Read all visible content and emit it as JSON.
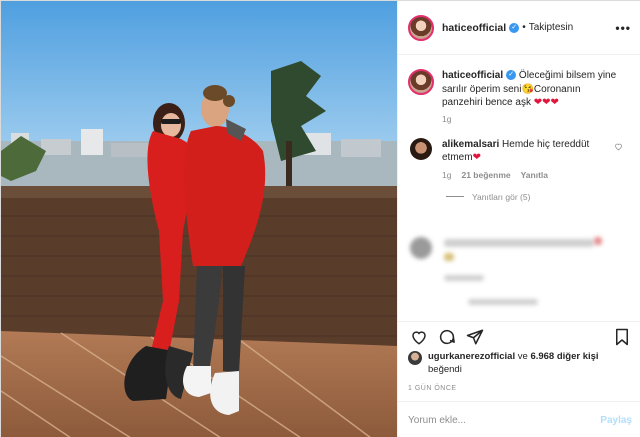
{
  "header": {
    "username": "haticeofficial",
    "separator": "•",
    "follow_status": "Takiptesin",
    "more_label": "•••"
  },
  "caption": {
    "username": "haticeofficial",
    "text_before_emoji": "Öleceğimi bilsem yine sarılır öperim seni",
    "text_after_emoji": "Coronanın panzehiri bence aşk",
    "hearts": "❤❤❤",
    "time": "1g"
  },
  "comment": {
    "username": "alikemalsari",
    "text": "Hemde hiç tereddüt etmem",
    "heart": "❤",
    "time": "1g",
    "likes": "21 beğenme",
    "reply_label": "Yanıtla",
    "view_replies": "Yanıtları gör (5)"
  },
  "likes": {
    "user": "ugurkanerezofficial",
    "connector": "ve",
    "count_text": "6.968 diğer kişi",
    "suffix": "beğendi"
  },
  "date": "1 GÜN ÖNCE",
  "comment_input": {
    "placeholder": "Yorum ekle...",
    "post_label": "Paylaş"
  },
  "icons": [
    "verified-icon",
    "more-icon",
    "heart-icon",
    "comment-icon",
    "share-icon",
    "bookmark-icon"
  ],
  "colors": {
    "accent_blue": "#3897f0",
    "heart_red": "#e0163c",
    "muted": "#8e8e8e",
    "post_disabled": "#b2dffc"
  }
}
